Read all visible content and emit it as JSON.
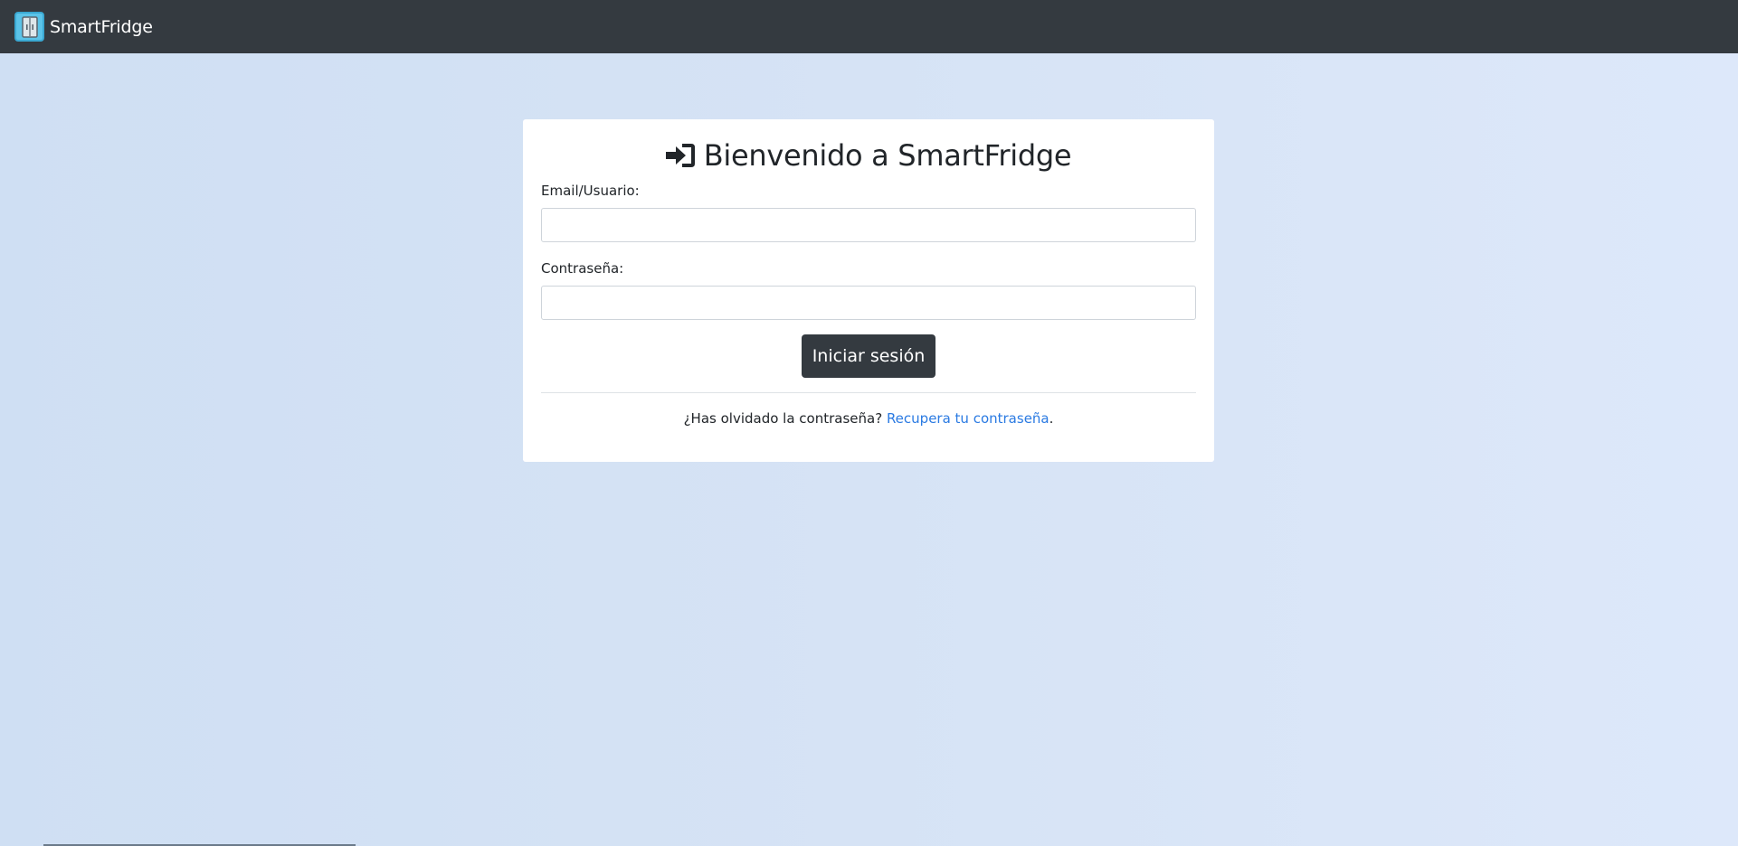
{
  "navbar": {
    "brand_text": "SmartFridge",
    "logo_icon": "fridge-icon",
    "background": "#343a40"
  },
  "login": {
    "title": "Bienvenido a SmartFridge",
    "title_icon": "sign-in-icon",
    "email_label": "Email/Usuario:",
    "email_value": "",
    "password_label": "Contraseña:",
    "password_value": "",
    "submit_label": "Iniciar sesión",
    "forgot_text": "¿Has olvidado la contraseña?",
    "recover_link": "Recupera tu contraseña",
    "recover_suffix": "."
  },
  "colors": {
    "link": "#2a7ae2",
    "button": "#343a40",
    "background_start": "#cfdff3",
    "background_end": "#dde8fa"
  }
}
